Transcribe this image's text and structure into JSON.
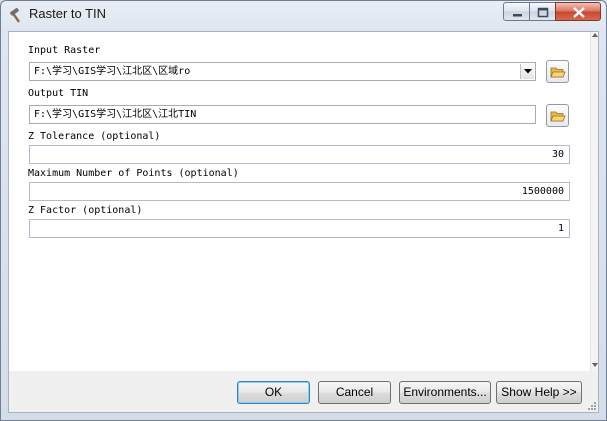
{
  "window": {
    "title": "Raster to TIN"
  },
  "params": [
    {
      "label": "Input Raster",
      "value": "F:\\学习\\GIS学习\\江北区\\区域ro"
    },
    {
      "label": "Output TIN",
      "value": "F:\\学习\\GIS学习\\江北区\\江北TIN"
    },
    {
      "label": "Z Tolerance (optional)",
      "value": "30"
    },
    {
      "label": "Maximum Number of Points (optional)",
      "value": "1500000"
    },
    {
      "label": "Z Factor (optional)",
      "value": "1"
    }
  ],
  "buttons": {
    "ok": "OK",
    "cancel": "Cancel",
    "environments": "Environments...",
    "show_help": "Show Help >>"
  },
  "icons": {
    "app": "hammer-icon",
    "browse": "open-folder-icon",
    "dropdown": "chevron-down-icon"
  }
}
